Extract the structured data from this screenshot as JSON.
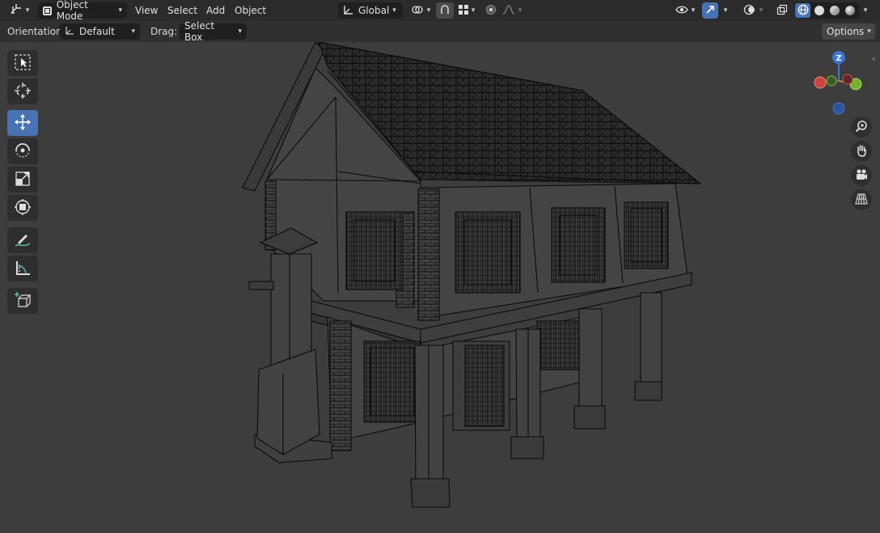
{
  "header": {
    "mode_label": "Object Mode",
    "menus": [
      "View",
      "Select",
      "Add",
      "Object"
    ],
    "transform_orientation": "Global"
  },
  "tool_settings": {
    "orientation_label": "Orientation:",
    "orientation_value": "Default",
    "drag_label": "Drag:",
    "drag_value": "Select Box",
    "options_label": "Options"
  },
  "gizmo": {
    "z_label": "Z",
    "x_color": "#d2403d",
    "y_color": "#74b22d",
    "z_color": "#3b75d8"
  },
  "toolbar": {
    "tools": [
      "select-box",
      "cursor",
      "move",
      "rotate",
      "scale",
      "transform",
      "annotate",
      "measure",
      "add-cube"
    ],
    "active_tool": "move"
  },
  "colors": {
    "accent": "#4772b3",
    "viewport_bg": "#3d3d3d",
    "header_bg": "#2b2b2b",
    "wire": "#0b0b0b"
  }
}
